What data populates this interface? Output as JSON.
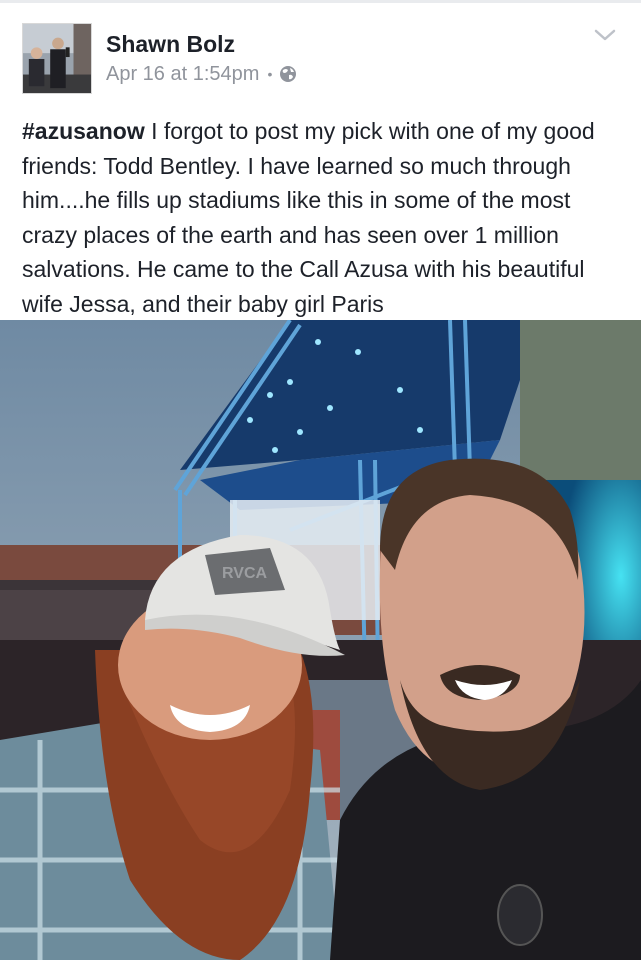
{
  "post": {
    "author": "Shawn Bolz",
    "timestamp": "Apr 16 at 1:54pm",
    "separator": "•",
    "privacy_icon": "globe-icon",
    "menu_icon": "chevron-down-icon",
    "hashtag": "#azusanow",
    "body": " I forgot to post my pick with one of my good friends: Todd Bentley. I have learned so much through him....he fills up stadiums like this in some of the most crazy places of the earth and has seen over 1 million salvations. He came to the Call Azusa with his beautiful wife Jessa, and their baby girl Paris"
  },
  "photo": {
    "hat_logo": "RVCA"
  },
  "colors": {
    "text": "#1d2129",
    "meta": "#90949c",
    "stage_light": "#2f7fe0"
  }
}
